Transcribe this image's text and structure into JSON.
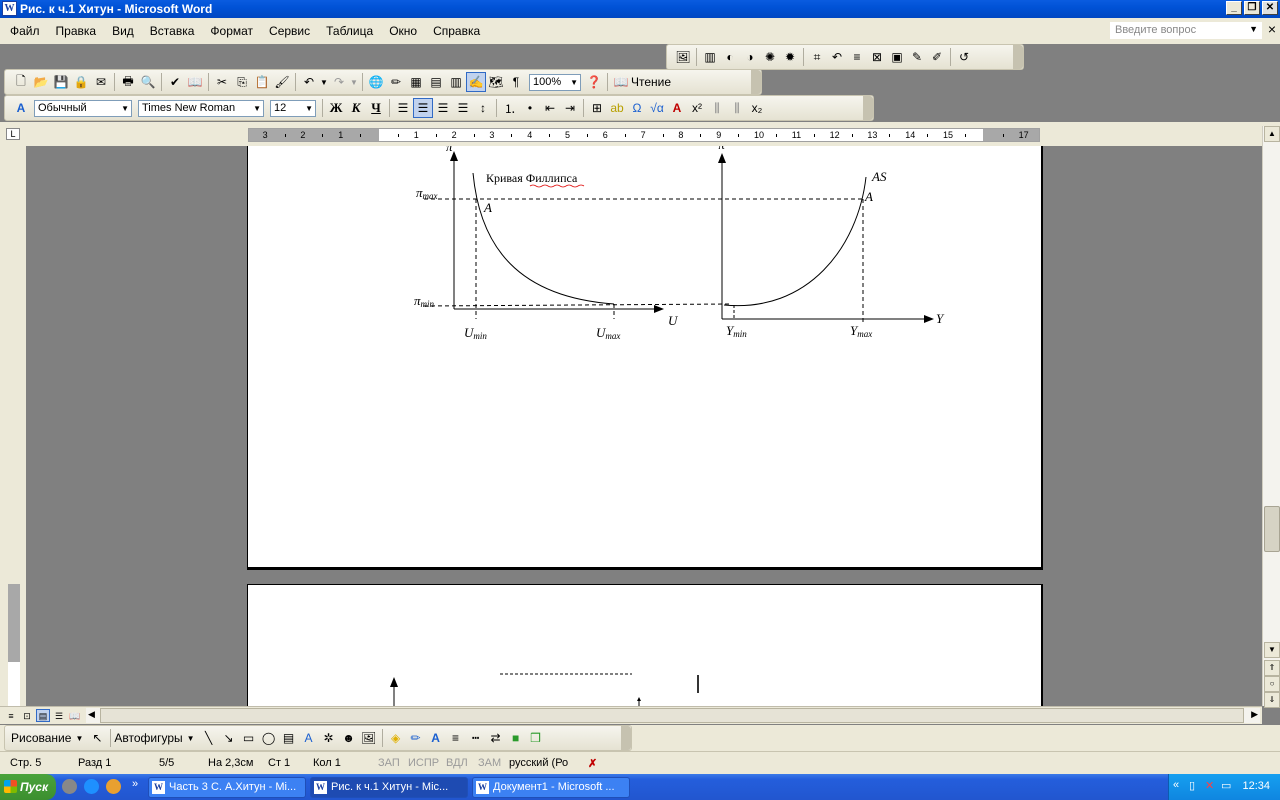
{
  "window": {
    "title": "Рис. к ч.1 Хитун - Microsoft Word"
  },
  "menu": {
    "items": [
      "Файл",
      "Правка",
      "Вид",
      "Вставка",
      "Формат",
      "Сервис",
      "Таблица",
      "Окно",
      "Справка"
    ],
    "question_placeholder": "Введите вопрос"
  },
  "standard_toolbar": {
    "zoom": "100%",
    "reading_label": "Чтение"
  },
  "format_toolbar": {
    "style": "Обычный",
    "font": "Times New Roman",
    "size": "12"
  },
  "ruler": {
    "numbers": [
      "3",
      "2",
      "1",
      "1",
      "2",
      "3",
      "4",
      "5",
      "6",
      "7",
      "8",
      "9",
      "10",
      "11",
      "12",
      "13",
      "14",
      "15",
      "17"
    ]
  },
  "figure": {
    "left": {
      "y_axis": "π",
      "x_axis": "U",
      "curve_label": "Кривая Филлипса",
      "point": "A",
      "y_max": "π",
      "y_max_sub": "max",
      "y_min": "π",
      "y_min_sub": "min",
      "x_min": "U",
      "x_min_sub": "min",
      "x_max": "U",
      "x_max_sub": "max"
    },
    "right": {
      "y_axis": "π",
      "x_axis": "Y",
      "curve_label": "AS",
      "point": "A",
      "x_min": "Y",
      "x_min_sub": "min",
      "x_max": "Y",
      "x_max_sub": "max"
    }
  },
  "drawing_toolbar": {
    "draw_label": "Рисование",
    "autoshapes_label": "Автофигуры"
  },
  "status": {
    "page": "Стр. 5",
    "section": "Разд 1",
    "pages": "5/5",
    "at": "На 2,3см",
    "line": "Ст 1",
    "col": "Кол 1",
    "rec": "ЗАП",
    "trk": "ИСПР",
    "ext": "ВДЛ",
    "ovr": "ЗАМ",
    "lang": "русский (Ро"
  },
  "taskbar": {
    "start": "Пуск",
    "tasks": [
      "Часть 3  С. А.Хитун - Mi...",
      "Рис. к ч.1 Хитун - Mic...",
      "Документ1 - Microsoft ..."
    ],
    "clock": "12:34"
  }
}
